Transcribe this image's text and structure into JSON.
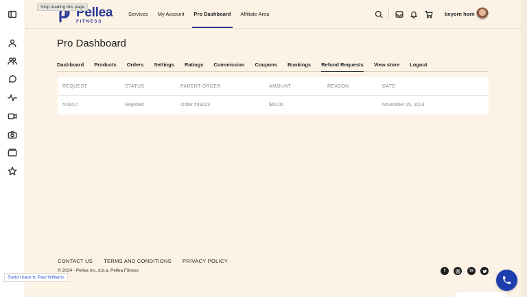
{
  "tooltip": "Stop loading this page",
  "brand": {
    "name": "Pellea",
    "sub": "FITNESS"
  },
  "nav": {
    "items": [
      {
        "label": "Services"
      },
      {
        "label": "My Account"
      },
      {
        "label": "Pro Dashboard"
      },
      {
        "label": "Affiliate Area"
      }
    ],
    "active": "Pro Dashboard"
  },
  "header_icons": [
    "search-icon",
    "inbox-icon",
    "bell-icon",
    "cart-icon"
  ],
  "user": {
    "name": "beyorn horn"
  },
  "rail_icons": [
    "sidebar-toggle-icon",
    "person-icon",
    "people-icon",
    "chat-icon",
    "activity-icon",
    "video-icon",
    "camera-icon",
    "folder-icon",
    "star-icon"
  ],
  "page": {
    "title": "Pro Dashboard"
  },
  "subtabs": {
    "items": [
      "Dashboard",
      "Products",
      "Orders",
      "Settings",
      "Ratings",
      "Commission",
      "Coupons",
      "Bookings",
      "Refund Requests",
      "View store",
      "Logout"
    ],
    "active": "Refund Requests"
  },
  "table": {
    "headers": [
      "REQUEST",
      "STATUS",
      "PARENT ORDER",
      "AMOUNT",
      "REASON",
      "DATE"
    ],
    "rows": [
      [
        "#49227",
        "Rejected",
        "Order #49223",
        "$50.00",
        "",
        "November 25, 2024"
      ]
    ]
  },
  "footer": {
    "links": [
      "CONTACT US",
      "TERMS AND CONDITIONS",
      "PRIVACY POLICY"
    ],
    "copyright": "© 2024 - Pellea Inc. d.b.a. Pellea Fitness",
    "social": [
      "facebook-icon",
      "instagram-icon",
      "linkedin-icon",
      "twitter-icon"
    ]
  },
  "switch_back": "Switch back to Paul Williams",
  "colors": {
    "brand": "#2a3a9a",
    "background": "#fcf3e6",
    "call_button": "#1d3fae"
  }
}
